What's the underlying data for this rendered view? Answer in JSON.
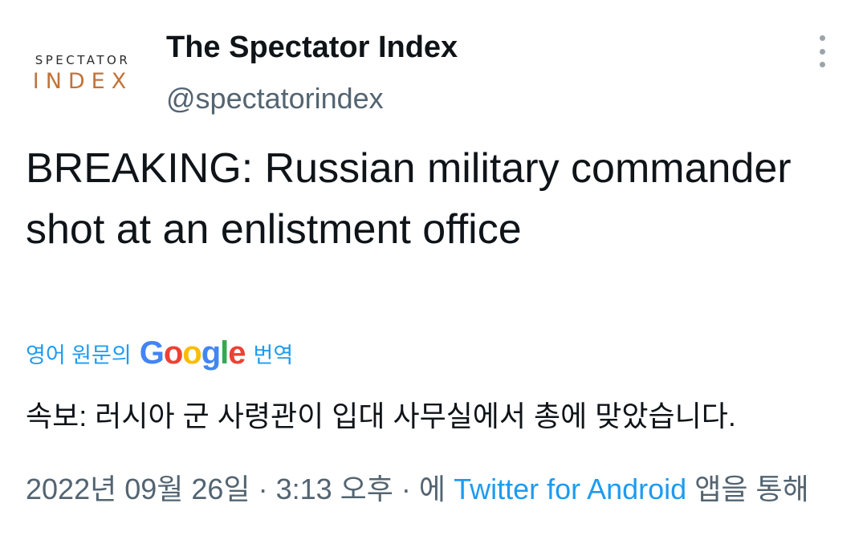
{
  "header": {
    "avatar_top": "SPECTATOR",
    "avatar_bottom": "INDEX",
    "display_name": "The Spectator Index",
    "handle": "@spectatorindex"
  },
  "tweet": {
    "text": "BREAKING: Russian military commander shot at an enlistment office"
  },
  "translation": {
    "prefix": "영어 원문의",
    "google_letters": [
      "G",
      "o",
      "o",
      "g",
      "l",
      "e"
    ],
    "suffix": "번역",
    "translated_text": "속보: 러시아 군 사령관이 입대 사무실에서 총에 맞았습니다."
  },
  "meta": {
    "date": "2022년 09월 26일",
    "separator": "·",
    "time": "3:13 오후",
    "via_prefix": "에",
    "source": "Twitter for Android",
    "via_suffix": "앱을 통해"
  },
  "colors": {
    "link": "#1d9bf0",
    "secondary_text": "#536471",
    "primary_text": "#0f1419",
    "logo_orange": "#c0733a"
  },
  "icons": {
    "more": "vertical-ellipsis-icon"
  }
}
